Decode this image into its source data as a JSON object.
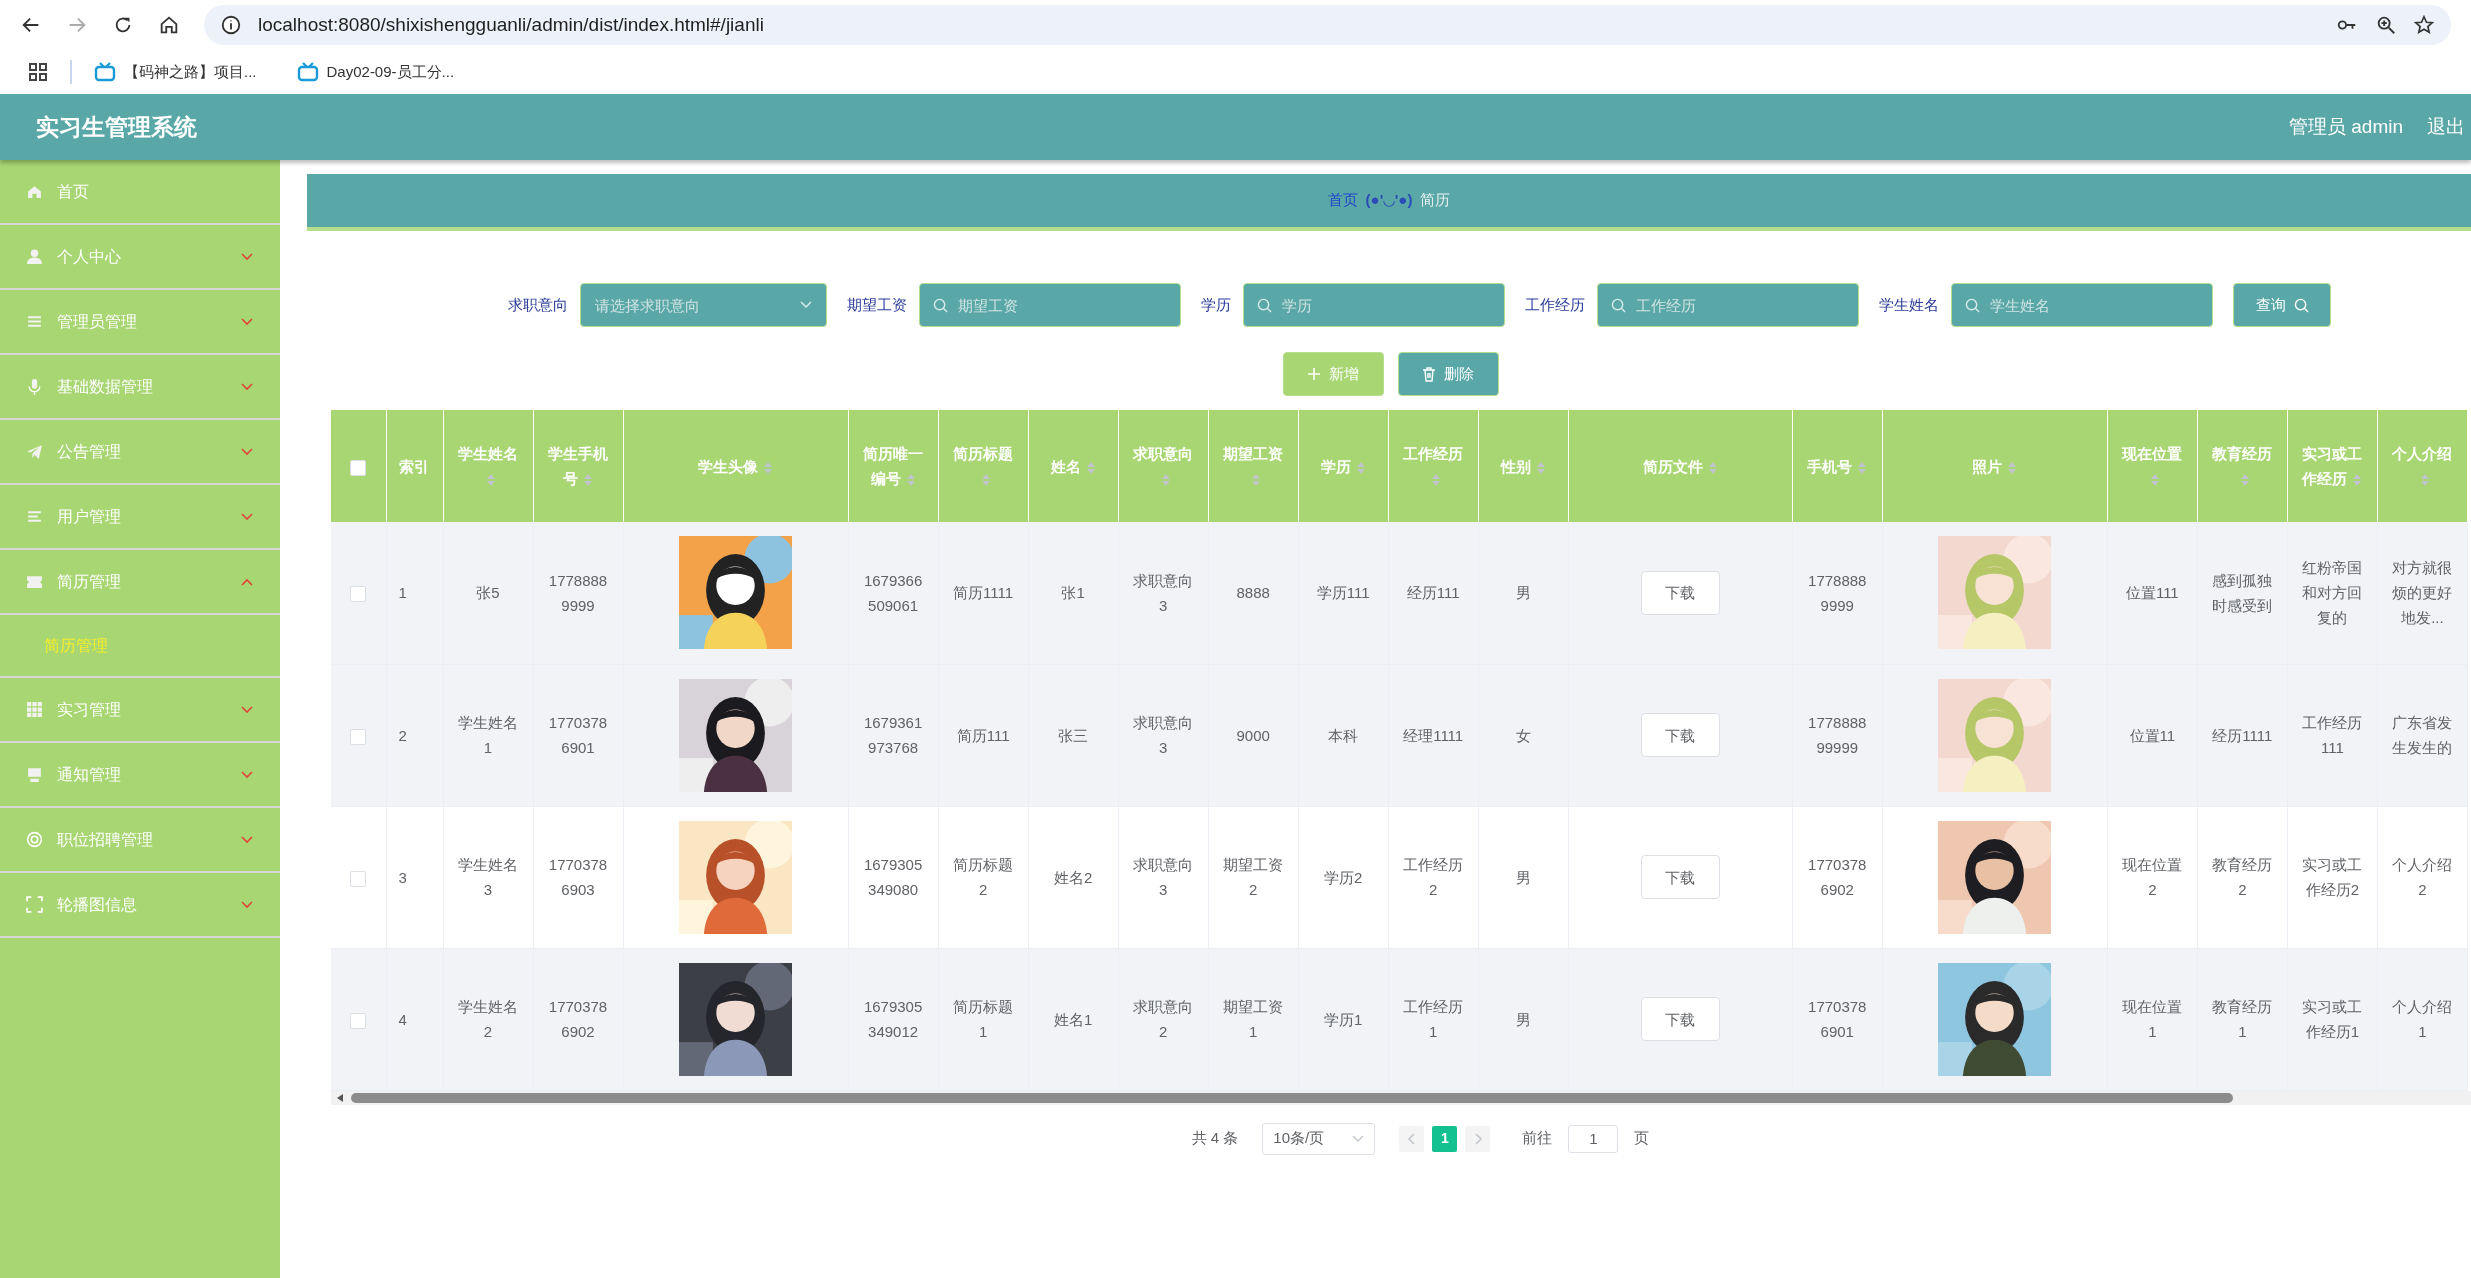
{
  "browser": {
    "url": "localhost:8080/shixishengguanli/admin/dist/index.html#/jianli",
    "bookmarks": [
      "【码神之路】项目...",
      "Day02-09-员工分..."
    ]
  },
  "header": {
    "title": "实习生管理系统",
    "user": "管理员 admin",
    "logout": "退出"
  },
  "sidebar": {
    "items": [
      {
        "label": "首页",
        "kind": "link"
      },
      {
        "label": "个人中心",
        "kind": "menu",
        "expanded": false
      },
      {
        "label": "管理员管理",
        "kind": "menu",
        "expanded": false
      },
      {
        "label": "基础数据管理",
        "kind": "menu",
        "expanded": false
      },
      {
        "label": "公告管理",
        "kind": "menu",
        "expanded": false
      },
      {
        "label": "用户管理",
        "kind": "menu",
        "expanded": false
      },
      {
        "label": "简历管理",
        "kind": "menu",
        "expanded": true,
        "children": [
          {
            "label": "简历管理",
            "selected": true
          }
        ]
      },
      {
        "label": "实习管理",
        "kind": "menu",
        "expanded": false
      },
      {
        "label": "通知管理",
        "kind": "menu",
        "expanded": false
      },
      {
        "label": "职位招聘管理",
        "kind": "menu",
        "expanded": false
      },
      {
        "label": "轮播图信息",
        "kind": "menu",
        "expanded": false
      }
    ]
  },
  "breadcrumb": {
    "home": "首页",
    "separator": "(●'◡'●)",
    "current": "简历"
  },
  "filters": [
    {
      "label": "求职意向",
      "kind": "select",
      "placeholder": "请选择求职意向"
    },
    {
      "label": "期望工资",
      "kind": "search",
      "placeholder": "期望工资"
    },
    {
      "label": "学历",
      "kind": "search",
      "placeholder": "学历"
    },
    {
      "label": "工作经历",
      "kind": "search",
      "placeholder": "工作经历"
    },
    {
      "label": "学生姓名",
      "kind": "search",
      "placeholder": "学生姓名"
    }
  ],
  "search_button": "查询",
  "actions": [
    {
      "label": "新增",
      "kind": "add"
    },
    {
      "label": "删除",
      "kind": "delete"
    }
  ],
  "table": {
    "select_all": {
      "checked": false
    },
    "columns": [
      {
        "title": "索引",
        "kind": "index",
        "sortable": false
      },
      {
        "title": "学生姓名",
        "kind": "text",
        "sortable": true
      },
      {
        "title": "学生手机号",
        "kind": "text",
        "sortable": true
      },
      {
        "title": "学生头像",
        "kind": "picture",
        "sortable": true
      },
      {
        "title": "简历唯一编号",
        "kind": "text",
        "sortable": true
      },
      {
        "title": "简历标题",
        "kind": "text",
        "sortable": true
      },
      {
        "title": "姓名",
        "kind": "text",
        "sortable": true
      },
      {
        "title": "求职意向",
        "kind": "text",
        "sortable": true
      },
      {
        "title": "期望工资",
        "kind": "text",
        "sortable": true
      },
      {
        "title": "学历",
        "kind": "text",
        "sortable": true
      },
      {
        "title": "工作经历",
        "kind": "text",
        "sortable": true
      },
      {
        "title": "性别",
        "kind": "text",
        "sortable": true
      },
      {
        "title": "简历文件",
        "kind": "file",
        "sortable": true
      },
      {
        "title": "手机号",
        "kind": "text",
        "sortable": true
      },
      {
        "title": "照片",
        "kind": "picture",
        "sortable": true
      },
      {
        "title": "现在位置",
        "kind": "text",
        "sortable": true
      },
      {
        "title": "教育经历",
        "kind": "text",
        "sortable": true
      },
      {
        "title": "实习或工作经历",
        "kind": "text",
        "sortable": true
      },
      {
        "title": "个人介绍",
        "kind": "text",
        "sortable": true
      }
    ],
    "rows": [
      {
        "checked": false,
        "shaded": true,
        "cells": [
          "1",
          "张5",
          "17788889999",
          {
            "kind": "picture"
          },
          "1679366509061",
          "简历1111",
          "张1",
          "求职意向3",
          "8888",
          "学历111",
          "经历111",
          "男",
          {
            "kind": "button",
            "label": "下载"
          },
          "17788889999",
          {
            "kind": "picture"
          },
          "位置111",
          "感到孤独时感受到",
          "红粉帝国和对方回复的",
          "对方就很烦的更好地发..."
        ]
      },
      {
        "checked": false,
        "shaded": true,
        "cells": [
          "2",
          "学生姓名1",
          "17703786901",
          {
            "kind": "picture"
          },
          "1679361973768",
          "简历111",
          "张三",
          "求职意向3",
          "9000",
          "本科",
          "经理1111",
          "女",
          {
            "kind": "button",
            "label": "下载"
          },
          "177888899999",
          {
            "kind": "picture"
          },
          "位置11",
          "经历1111",
          "工作经历111",
          "广东省发生发生的"
        ]
      },
      {
        "checked": false,
        "shaded": false,
        "cells": [
          "3",
          "学生姓名3",
          "17703786903",
          {
            "kind": "picture"
          },
          "1679305349080",
          "简历标题2",
          "姓名2",
          "求职意向3",
          "期望工资2",
          "学历2",
          "工作经历2",
          "男",
          {
            "kind": "button",
            "label": "下载"
          },
          "17703786902",
          {
            "kind": "picture"
          },
          "现在位置2",
          "教育经历2",
          "实习或工作经历2",
          "个人介绍2"
        ]
      },
      {
        "checked": false,
        "shaded": true,
        "cells": [
          "4",
          "学生姓名2",
          "17703786902",
          {
            "kind": "picture"
          },
          "1679305349012",
          "简历标题1",
          "姓名1",
          "求职意向2",
          "期望工资1",
          "学历1",
          "工作经历1",
          "男",
          {
            "kind": "button",
            "label": "下载"
          },
          "17703786901",
          {
            "kind": "picture"
          },
          "现在位置1",
          "教育经历1",
          "实习或工作经历1",
          "个人介绍1"
        ]
      }
    ]
  },
  "pagination": {
    "total": "共 4 条",
    "page_size": "10条/页",
    "pages": [
      {
        "label": "1",
        "selected": true
      }
    ],
    "goto_label": "前往",
    "goto_value": "1",
    "page_suffix": "页"
  }
}
